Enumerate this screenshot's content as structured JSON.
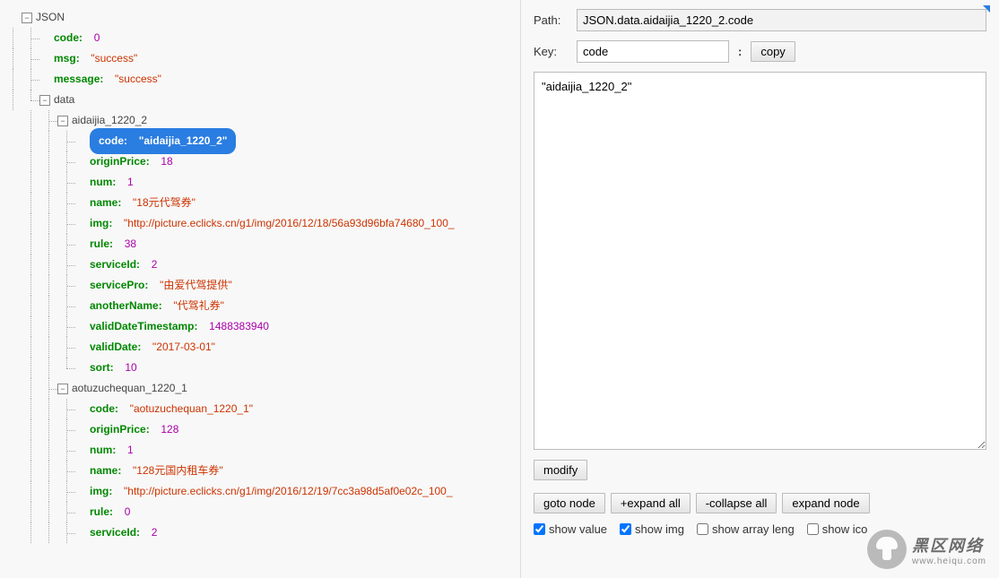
{
  "tree": {
    "root": "JSON",
    "code_key": "code",
    "code_val": "0",
    "msg_key": "msg",
    "msg_val": "\"success\"",
    "message_key": "message",
    "message_val": "\"success\"",
    "data_key": "data",
    "obj1": "aidaijia_1220_2",
    "obj1_fields": {
      "code_k": "code",
      "code_v": "\"aidaijia_1220_2\"",
      "originPrice_k": "originPrice",
      "originPrice_v": "18",
      "num_k": "num",
      "num_v": "1",
      "name_k": "name",
      "name_v": "\"18元代驾券\"",
      "img_k": "img",
      "img_v": "\"http://picture.eclicks.cn/g1/img/2016/12/18/56a93d96bfa74680_100_",
      "rule_k": "rule",
      "rule_v": "38",
      "serviceId_k": "serviceId",
      "serviceId_v": "2",
      "servicePro_k": "servicePro",
      "servicePro_v": "\"由爱代驾提供\"",
      "anotherName_k": "anotherName",
      "anotherName_v": "\"代驾礼券\"",
      "validDateTimestamp_k": "validDateTimestamp",
      "validDateTimestamp_v": "1488383940",
      "validDate_k": "validDate",
      "validDate_v": "\"2017-03-01\"",
      "sort_k": "sort",
      "sort_v": "10"
    },
    "obj2": "aotuzuchequan_1220_1",
    "obj2_fields": {
      "code_k": "code",
      "code_v": "\"aotuzuchequan_1220_1\"",
      "originPrice_k": "originPrice",
      "originPrice_v": "128",
      "num_k": "num",
      "num_v": "1",
      "name_k": "name",
      "name_v": "\"128元国内租车券\"",
      "img_k": "img",
      "img_v": "\"http://picture.eclicks.cn/g1/img/2016/12/19/7cc3a98d5af0e02c_100_",
      "rule_k": "rule",
      "rule_v": "0",
      "serviceId_k": "serviceId",
      "serviceId_v": "2"
    }
  },
  "right": {
    "path_label": "Path:",
    "path_value": "JSON.data.aidaijia_1220_2.code",
    "key_label": "Key:",
    "key_value": "code",
    "copy_btn": "copy",
    "textarea_value": "\"aidaijia_1220_2\"",
    "modify_btn": "modify",
    "goto_btn": "goto node",
    "expand_all_btn": "+expand all",
    "collapse_all_btn": "-collapse all",
    "expand_node_btn": "expand node",
    "show_value": "show value",
    "show_img": "show img",
    "show_array": "show array leng",
    "show_ico": "show ico"
  },
  "watermark": {
    "text_big": "黑区网络",
    "text_small": "www.heiqu.com"
  }
}
